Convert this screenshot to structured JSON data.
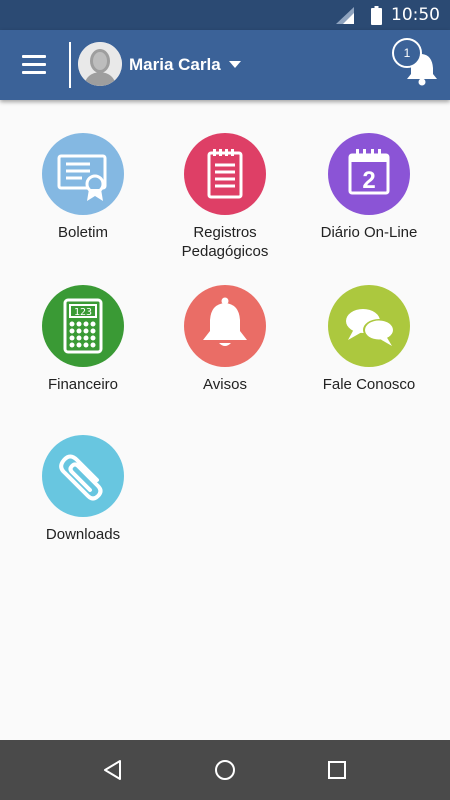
{
  "status_bar": {
    "time": "10:50",
    "icons": [
      "signal-icon",
      "battery-icon"
    ]
  },
  "app_bar": {
    "menu_icon": "hamburger-menu-icon",
    "user_name": "Maria Carla",
    "dropdown_icon": "caret-down-icon",
    "notification_count": "1",
    "notification_icon": "bell-icon"
  },
  "tiles": [
    {
      "label": "Boletim",
      "icon": "certificate-icon",
      "color": "#84b8e2"
    },
    {
      "label": "Registros Pedagógicos",
      "icon": "notepad-icon",
      "color": "#de3f66"
    },
    {
      "label": "Diário On-Line",
      "icon": "calendar-icon",
      "color": "#8b54d6"
    },
    {
      "label": "Financeiro",
      "icon": "calculator-icon",
      "color": "#3a9a35"
    },
    {
      "label": "Avisos",
      "icon": "bell-icon",
      "color": "#ea6d66"
    },
    {
      "label": "Fale Conosco",
      "icon": "chat-bubbles-icon",
      "color": "#acc83e"
    },
    {
      "label": "Downloads",
      "icon": "paperclip-icon",
      "color": "#68c6e0"
    }
  ],
  "calendar_day": "2",
  "calculator_display": "123",
  "nav_bar": [
    "back-icon",
    "home-icon",
    "recents-icon"
  ],
  "colors": {
    "status_bar": "#2b4a73",
    "app_bar": "#3b6298",
    "background": "#fafafa",
    "nav_bar": "#4a4a4a"
  }
}
